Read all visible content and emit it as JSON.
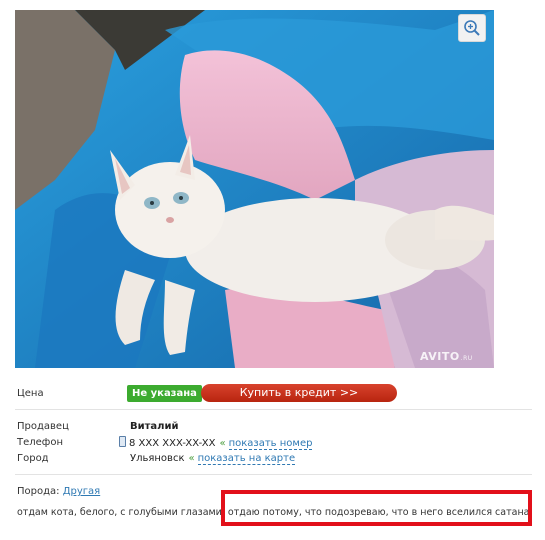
{
  "photo": {
    "zoom_icon": "zoom-in-icon",
    "watermark": "AVITO",
    "watermark_suffix": ".RU"
  },
  "price": {
    "label": "Цена",
    "badge": "Не указана",
    "badge_color": "#3cab2f",
    "credit_button": "Купить в кредит >>",
    "credit_button_color": "#c5311b"
  },
  "details": {
    "seller_label": "Продавец",
    "seller_value": "Виталий",
    "phone_label": "Телефон",
    "phone_icon": "phone-icon",
    "phone_value": "8 XXX XXX-XX-XX",
    "phone_link": "показать номер",
    "city_label": "Город",
    "city_value": "Ульяновск",
    "city_link": "показать на карте"
  },
  "description": {
    "breed_label": "Порода:",
    "breed_value": "Другая",
    "text_part1": "отдам кота, белого, с голубыми глазами,",
    "text_part2": "отдаю потому, что подозреваю, что в него вселился сатана."
  },
  "highlight_color": "#e2101a"
}
